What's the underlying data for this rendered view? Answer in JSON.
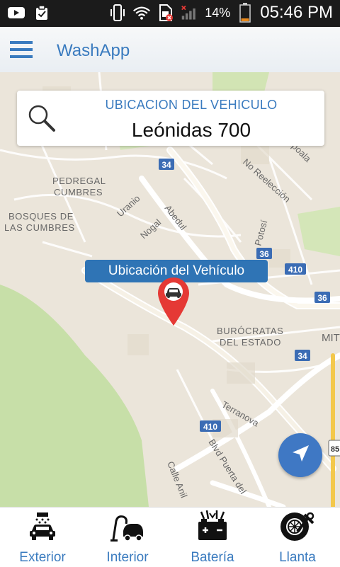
{
  "status_bar": {
    "battery_percent": "14%",
    "time": "05:46 PM",
    "icons": [
      "youtube-icon",
      "clipboard-check-icon",
      "vibrate-icon",
      "wifi-icon",
      "sim-error-icon",
      "signal-icon",
      "battery-icon"
    ]
  },
  "app_bar": {
    "title": "WashApp",
    "menu_icon": "hamburger-menu-icon"
  },
  "search": {
    "label": "UBICACION DEL VEHICULO",
    "value": "Leónidas 700",
    "icon": "search-icon"
  },
  "map": {
    "tooltip": "Ubicación del Vehículo",
    "pin_icon": "car-icon",
    "labels": {
      "pedregal_1": "PEDREGAL",
      "pedregal_2": "CUMBRES",
      "bosques_1": "BOSQUES DE",
      "bosques_2": "LAS CUMBRES",
      "uranio": "Uranio",
      "nogal": "Nogal",
      "abedul": "Abedul",
      "no_reeleccion": "No Reelección",
      "potosi": "Potosí",
      "pompola": "npoala",
      "burocratas_1": "BURÓCRATAS",
      "burocratas_2": "DEL ESTADO",
      "mit": "MIT",
      "terranova": "Terranova",
      "blvd": "Blvd Puerta del",
      "calle": "Calle Anil",
      "shield_34a": "34",
      "shield_34b": "34",
      "shield_36a": "36",
      "shield_36b": "36",
      "shield_410a": "410",
      "shield_410b": "410",
      "shield_85": "85"
    }
  },
  "bottom_nav": [
    {
      "label": "Exterior",
      "icon": "car-wash-icon"
    },
    {
      "label": "Interior",
      "icon": "vacuum-icon"
    },
    {
      "label": "Batería",
      "icon": "battery-charge-icon"
    },
    {
      "label": "Llanta",
      "icon": "tire-wrench-icon"
    }
  ],
  "colors": {
    "accent": "#3a7bbf",
    "tooltip": "#2f74b5",
    "pin": "#e53935",
    "locate": "#3f78c4"
  }
}
